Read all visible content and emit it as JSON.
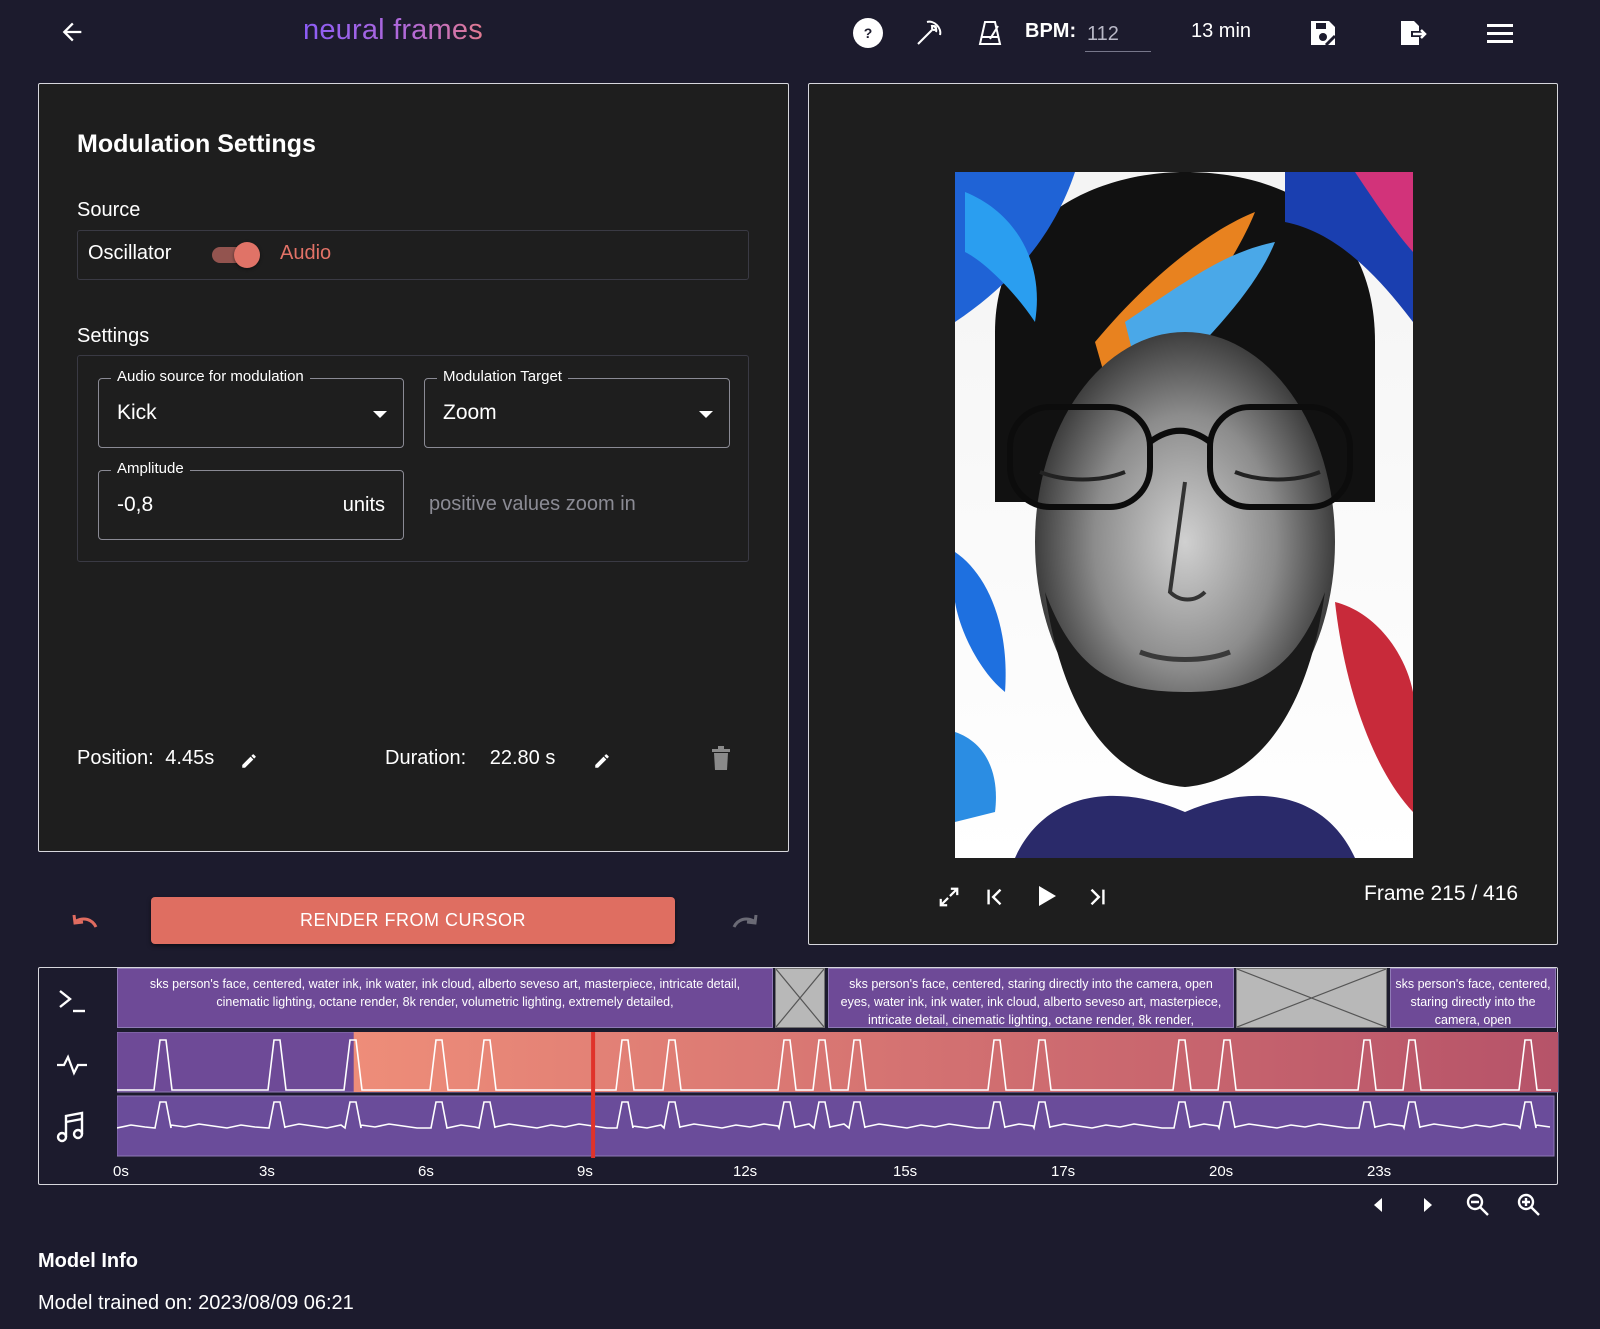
{
  "header": {
    "app_title": "neural frames",
    "bpm_label": "BPM:",
    "bpm_value": "112",
    "duration": "13 min"
  },
  "modulation": {
    "title": "Modulation Settings",
    "source_heading": "Source",
    "source_left": "Oscillator",
    "source_right": "Audio",
    "source_selected": "Audio",
    "settings_heading": "Settings",
    "audio_source_label": "Audio source for modulation",
    "audio_source_value": "Kick",
    "target_label": "Modulation Target",
    "target_value": "Zoom",
    "amplitude_label": "Amplitude",
    "amplitude_value": "-0,8",
    "amplitude_unit": "units",
    "hint": "positive values zoom in",
    "position_label": "Position:",
    "position_value": "4.45s",
    "duration_label": "Duration:",
    "duration_value": "22.80 s"
  },
  "preview": {
    "frame_label": "Frame 215 / 416"
  },
  "render": {
    "button_label": "RENDER FROM CURSOR"
  },
  "timeline": {
    "prompts": [
      "sks person's face, centered, water ink, ink water, ink cloud, alberto seveso art, masterpiece, intricate detail, cinematic lighting, octane render, 8k render, volumetric lighting, extremely detailed,",
      "sks person's face, centered, staring directly into the camera, open eyes, water ink, ink water, ink cloud, alberto seveso art, masterpiece, intricate detail, cinematic lighting, octane render, 8k render,",
      "sks person's face, centered, staring directly into the camera, open"
    ],
    "ticks": [
      "0s",
      "3s",
      "6s",
      "9s",
      "12s",
      "15s",
      "17s",
      "20s",
      "23s"
    ],
    "modulation_start_s": 4.45,
    "modulation_duration_s": 22.8,
    "cursor_s": 8.95
  },
  "model_info": {
    "heading": "Model Info",
    "trained_on": "Model trained on: 2023/08/09 06:21"
  },
  "colors": {
    "accent": "#df6e61",
    "background": "#1c1b2d",
    "panel": "#1e1e1e",
    "prompt_block": "#6e4a97",
    "cursor": "#e0332a"
  }
}
